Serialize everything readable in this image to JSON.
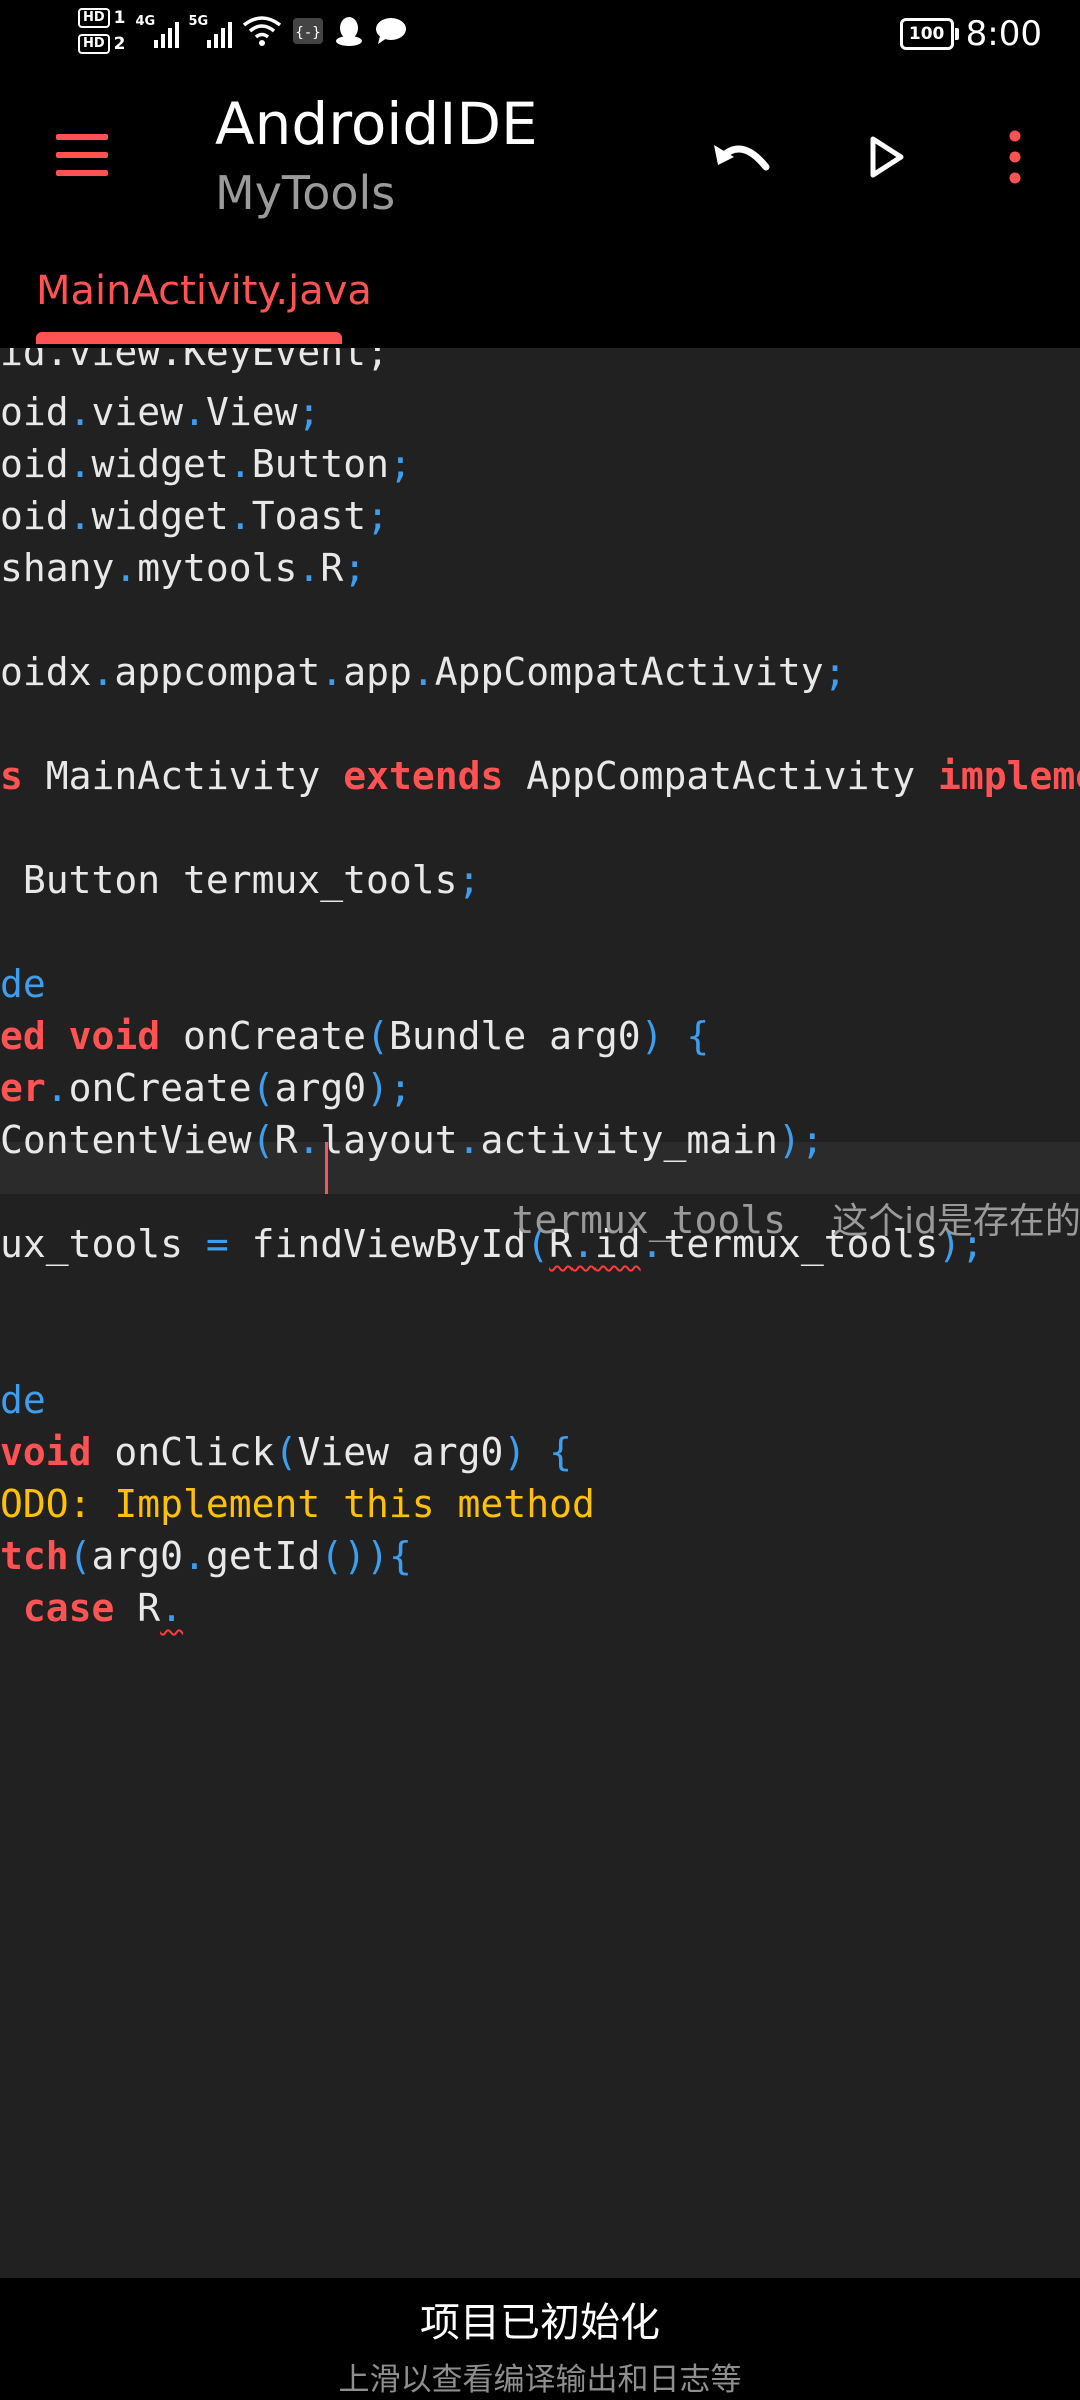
{
  "status_bar": {
    "sim1_label": "HD",
    "sim1_index": "1",
    "sim2_label": "HD",
    "sim2_index": "2",
    "network1": "4G",
    "network2": "5G",
    "battery": "100",
    "time": "8:00",
    "icons": [
      "signal-icon",
      "wifi-icon",
      "qq-icon",
      "chat-icon"
    ]
  },
  "app_bar": {
    "title": "AndroidIDE",
    "subtitle": "MyTools",
    "actions": [
      "undo-icon",
      "run-icon",
      "more-icon"
    ],
    "accent": "#ff5252"
  },
  "tabs": [
    {
      "label": "MainActivity.java",
      "active": true
    }
  ],
  "editor": {
    "background": "#212121",
    "completion_hint": {
      "item": "termux_tools",
      "description": "这个id是存在的"
    }
  },
  "bottom_panel": {
    "title": "项目已初始化",
    "subtitle": "上滑以查看编译输出和日志等"
  }
}
